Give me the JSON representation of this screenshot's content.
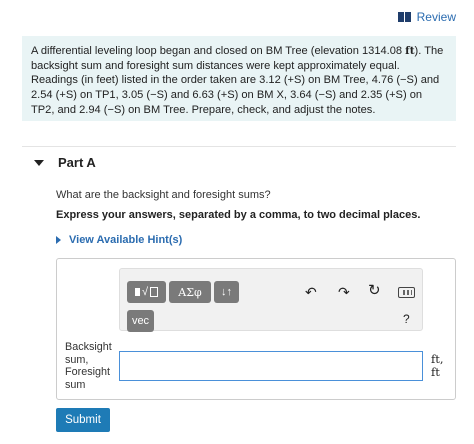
{
  "header": {
    "review_label": "Review"
  },
  "problem": {
    "text_before_unit": "A differential leveling loop began and closed on BM Tree (elevation 1314.08 ",
    "unit": "ft",
    "text_after_unit": "). The backsight sum and foresight sum distances were kept approximately equal. Readings (in feet) listed in the order taken are 3.12 (+S) on BM Tree, 4.76 (−S) and 2.54 (+S) on TP1, 3.05 (−S) and 6.63 (+S) on BM X, 3.64 (−S) and 2.35 (+S) on TP2, and 2.94 (−S) on BM Tree. Prepare, check, and adjust the notes."
  },
  "part": {
    "label": "Part A"
  },
  "question": {
    "prompt": "What are the backsight and foresight sums?",
    "instruction": "Express your answers, separated by a comma, to two decimal places.",
    "hint_label": "View Available Hint(s)"
  },
  "toolbar": {
    "template_label": "√",
    "greek_label": "ΑΣφ",
    "sort_label": "↓↑",
    "vec_label": "vec",
    "undo_glyph": "↶",
    "redo_glyph": "↷",
    "reset_glyph": "↻",
    "help_label": "?"
  },
  "answer": {
    "field_label_line1": "Backsight",
    "field_label_line2": "sum,",
    "field_label_line3": "Foresight",
    "field_label_line4": "sum",
    "value": "",
    "unit_line1": "ft,",
    "unit_line2": "ft"
  },
  "actions": {
    "submit_label": "Submit"
  }
}
